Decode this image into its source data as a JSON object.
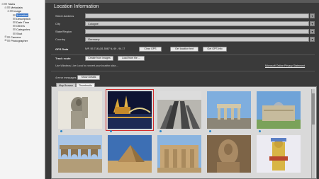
{
  "sidebar": {
    "items": [
      {
        "label": "Tasks",
        "depth": 0,
        "glyph": "⊟"
      },
      {
        "label": "Metadata",
        "depth": 1,
        "glyph": "⊟"
      },
      {
        "label": "Image",
        "depth": 2,
        "glyph": "⊟"
      },
      {
        "label": "Location",
        "depth": 3,
        "glyph": "",
        "selected": true
      },
      {
        "label": "Description",
        "depth": 3,
        "glyph": ""
      },
      {
        "label": "Date Time",
        "depth": 3,
        "glyph": ""
      },
      {
        "label": "Others",
        "depth": 3,
        "glyph": ""
      },
      {
        "label": "Categories",
        "depth": 3,
        "glyph": ""
      },
      {
        "label": "Shot",
        "depth": 3,
        "glyph": ""
      },
      {
        "label": "Camera",
        "depth": 1,
        "glyph": "⊞"
      },
      {
        "label": "Photographer",
        "depth": 1,
        "glyph": "⊞"
      }
    ]
  },
  "header": {
    "title": "Location Information"
  },
  "form": {
    "street_label": "Street Address",
    "street_value": "",
    "city_label": "City",
    "city_value": "Cologne",
    "state_label": "State/Region",
    "state_value": "",
    "country_label": "Country",
    "country_value": "Germany",
    "dropdown_glyph": "▾"
  },
  "gps": {
    "label": "GPS Data",
    "value": "N/P, 55.7141(51.5567 N, 69 , 94.17",
    "clear_btn": "Clear GPS",
    "get_text_btn": "Get location text",
    "get_info_btn": "Get GPS info"
  },
  "track": {
    "label": "Track route",
    "create_btn": "Create from images",
    "load_btn": "Load from file ..."
  },
  "hint": "Use Windows Live Local to convert your location data ...",
  "privacy_link": "Microsoft Online Privacy Statement",
  "errors": {
    "text": "4 error messages",
    "show_btn": "Show Details"
  },
  "tabs": {
    "map": "Map Browse",
    "thumbs": "Thumbnails"
  },
  "colors": {
    "selection": "#3d78c8",
    "selected_thumb_border": "#d42d2d",
    "pin": "#2a86c7"
  },
  "thumbnails": [
    {
      "name": "statue"
    },
    {
      "name": "cologne-cathedral-night"
    },
    {
      "name": "holocaust-memorial"
    },
    {
      "name": "brandenburg-gate"
    },
    {
      "name": "reichstag"
    },
    {
      "name": "aqueduct"
    },
    {
      "name": "desert-pyramid"
    },
    {
      "name": "egyptian-temple"
    },
    {
      "name": "stone-carving"
    },
    {
      "name": "golden-statue"
    }
  ]
}
